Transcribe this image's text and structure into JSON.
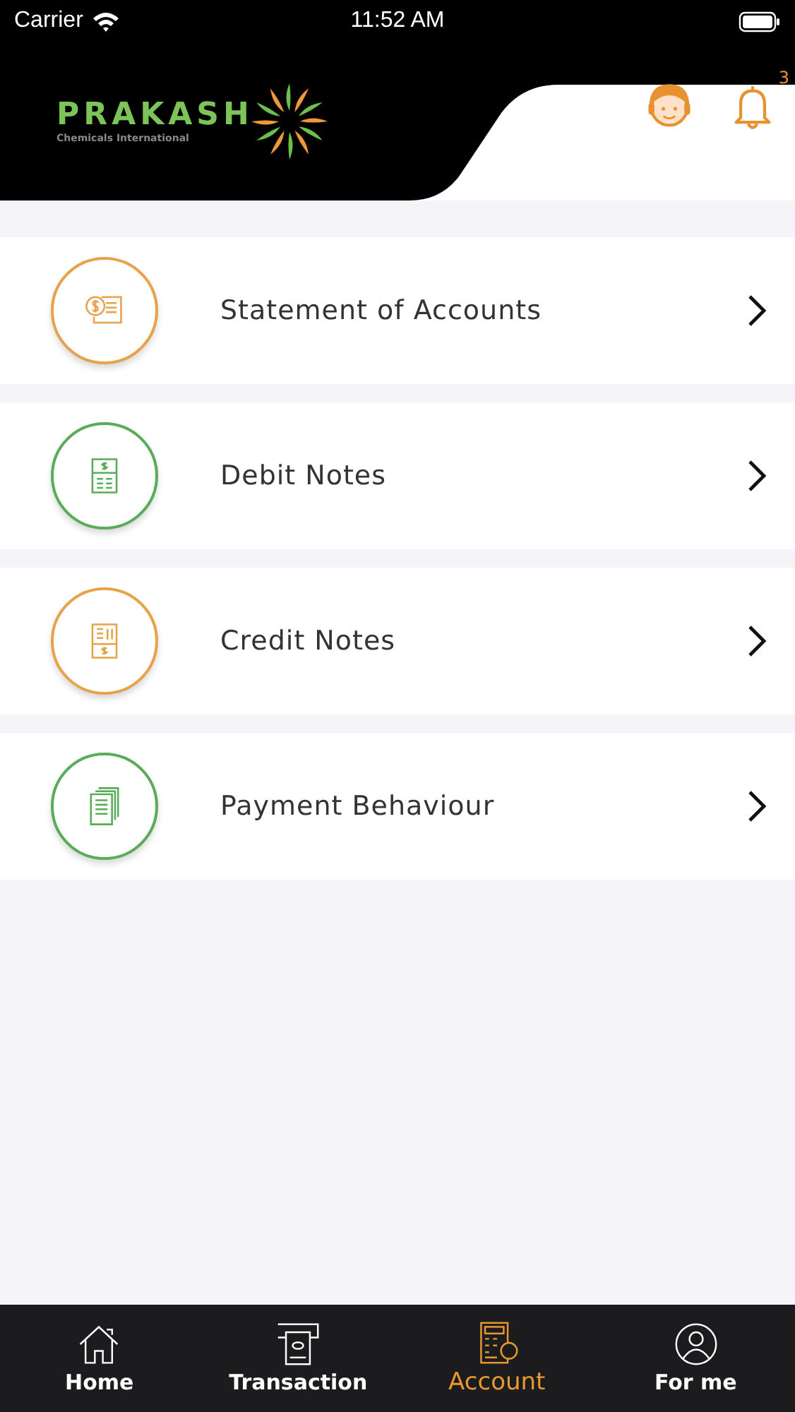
{
  "status_bar": {
    "carrier": "Carrier",
    "time": "11:52 AM"
  },
  "header": {
    "brand": "PRAKASH",
    "tagline": "Chemicals International",
    "notification_count": "3"
  },
  "menu": [
    {
      "label": "Statement of Accounts",
      "color": "#e8a24a"
    },
    {
      "label": "Debit Notes",
      "color": "#5aab5a"
    },
    {
      "label": "Credit Notes",
      "color": "#e8a24a"
    },
    {
      "label": "Payment Behaviour",
      "color": "#5aab5a"
    }
  ],
  "tabs": [
    {
      "label": "Home",
      "selected": false
    },
    {
      "label": "Transaction",
      "selected": false
    },
    {
      "label": "Account",
      "selected": true
    },
    {
      "label": "For me",
      "selected": false
    }
  ]
}
